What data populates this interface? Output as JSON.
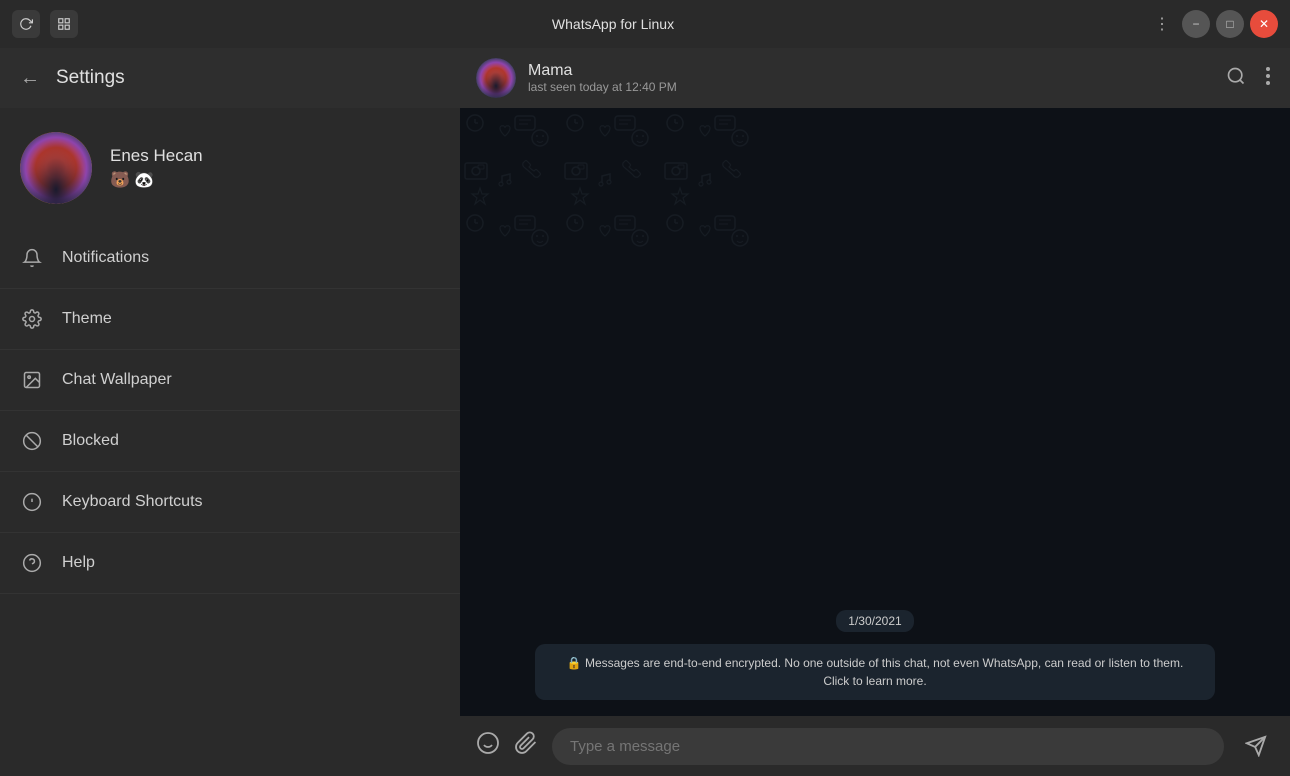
{
  "titlebar": {
    "title": "WhatsApp for Linux",
    "dots_label": "⋮",
    "minimize_label": "−",
    "maximize_label": "□",
    "close_label": "✕"
  },
  "settings": {
    "back_label": "←",
    "title": "Settings",
    "profile": {
      "name": "Enes Hecan",
      "emoji": "🐻 🐼"
    },
    "menu_items": [
      {
        "id": "notifications",
        "label": "Notifications",
        "icon": "bell"
      },
      {
        "id": "theme",
        "label": "Theme",
        "icon": "gear"
      },
      {
        "id": "chat-wallpaper",
        "label": "Chat Wallpaper",
        "icon": "image"
      },
      {
        "id": "blocked",
        "label": "Blocked",
        "icon": "blocked"
      },
      {
        "id": "keyboard-shortcuts",
        "label": "Keyboard Shortcuts",
        "icon": "keyboard"
      },
      {
        "id": "help",
        "label": "Help",
        "icon": "help"
      }
    ]
  },
  "chat": {
    "contact_name": "Mama",
    "last_seen": "last seen today at 12:40 PM",
    "date_badge": "1/30/2021",
    "encryption_notice": "🔒 Messages are end-to-end encrypted. No one outside of this chat, not even WhatsApp, can read or listen to them. Click to learn more.",
    "input_placeholder": "Type a message"
  }
}
